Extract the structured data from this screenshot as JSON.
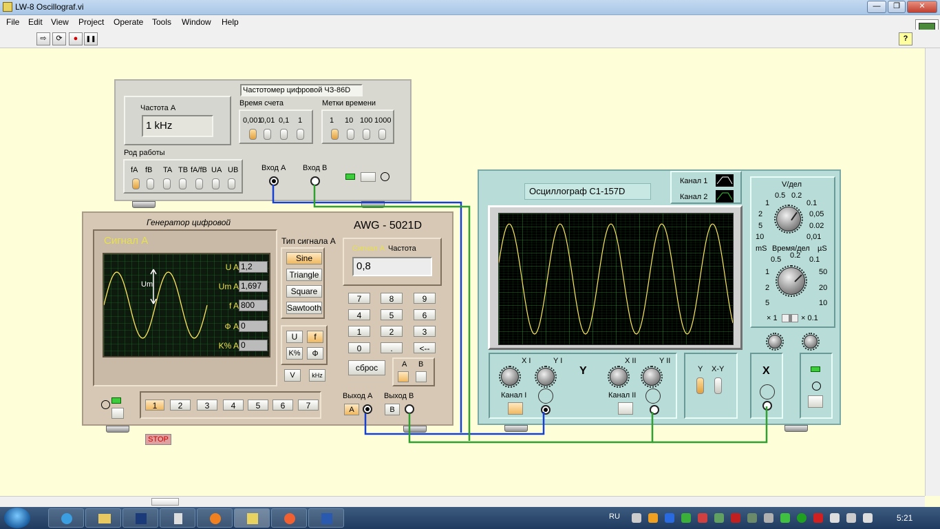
{
  "window": {
    "title": "LW-8 Oscillograf.vi",
    "min": "—",
    "max": "❐",
    "close": "✕"
  },
  "menu": [
    "File",
    "Edit",
    "View",
    "Project",
    "Operate",
    "Tools",
    "Window",
    "Help"
  ],
  "toolbar": {
    "run": "⇨",
    "run_cont": "⟳",
    "abort": "●",
    "pause": "❚❚",
    "help": "?"
  },
  "counter": {
    "title": "Частотомер цифровой ЧЗ-86D",
    "freq_label": "Частота А",
    "freq_value": "1 kHz",
    "count_time_label": "Время счета",
    "count_time_opts": [
      "0,001",
      "0,01",
      "0,1",
      "1"
    ],
    "marks_label": "Метки времени",
    "marks_opts": [
      "1",
      "10",
      "100",
      "1000"
    ],
    "mode_label": "Род работы",
    "mode_opts": [
      "fA",
      "fB",
      "TA",
      "TB",
      "fA/fB",
      "UA",
      "UB"
    ],
    "input_a": "Вход А",
    "input_b": "Вход В"
  },
  "generator": {
    "title": "Генератор цифровой",
    "model": "AWG - 5021D",
    "signal_a": "Сигнал А",
    "um_label": "Um",
    "params": [
      {
        "label": "U A",
        "value": "1,2"
      },
      {
        "label": "Um A",
        "value": "1,697"
      },
      {
        "label": "f A",
        "value": "800"
      },
      {
        "label": "Ф A",
        "value": "0"
      },
      {
        "label": "K% A",
        "value": "0"
      }
    ],
    "type_label": "Тип сигнала А",
    "types": [
      "Sine",
      "Triangle",
      "Square",
      "Sawtooth"
    ],
    "freq_signal": "Сигнал А",
    "freq_label": "Частота",
    "freq_value": "0,8",
    "keys": [
      "7",
      "8",
      "9",
      "4",
      "5",
      "6",
      "1",
      "2",
      "3",
      "0",
      ".",
      "<--"
    ],
    "reset": "сброс",
    "ab_a": "A",
    "ab_b": "B",
    "uf_u": "U",
    "uf_f": "f",
    "k_btn": "K%",
    "phi_btn": "Ф",
    "v_btn": "V",
    "khz_btn": "kHz",
    "presets": [
      "1",
      "2",
      "3",
      "4",
      "5",
      "6",
      "7"
    ],
    "out_a": "Выход А",
    "out_b": "Выход В",
    "out_a_btn": "A",
    "out_b_btn": "B",
    "stop": "STOP"
  },
  "oscilloscope": {
    "title": "Осциллограф С1-157D",
    "ch1": "Канал 1",
    "ch2": "Канал 2",
    "vdiv_label": "V/дел",
    "vdiv_scale": [
      "0.5",
      "0.2",
      "0.1",
      "0,05",
      "0.02",
      "0,01",
      "10",
      "5",
      "2",
      "1"
    ],
    "time_label": "Время/дел",
    "ms": "mS",
    "us": "µS",
    "time_scale": [
      "0.5",
      "0.2",
      "0.1",
      "50",
      "20",
      "10",
      "5",
      "2",
      "1"
    ],
    "x1": "× 1",
    "x01": "× 0.1",
    "xi": "X I",
    "yi": "Y I",
    "xii": "X II",
    "yii": "Y II",
    "y_big": "Y",
    "x_big": "X",
    "ch_i": "Канал I",
    "ch_ii": "Канал II",
    "mode_y": "Y",
    "mode_xy": "X-Y"
  },
  "taskbar": {
    "lang": "RU",
    "clock": "5:21"
  }
}
